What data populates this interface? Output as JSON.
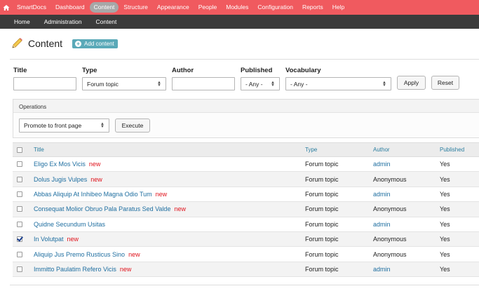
{
  "toolbar": {
    "items": [
      "SmartDocs",
      "Dashboard",
      "Content",
      "Structure",
      "Appearance",
      "People",
      "Modules",
      "Configuration",
      "Reports",
      "Help"
    ],
    "active": "Content",
    "accent_color": "#f05a5f"
  },
  "subbar": {
    "items": [
      "Home",
      "Administration",
      "Content"
    ]
  },
  "page": {
    "title": "Content",
    "add_button": "Add content"
  },
  "filters": {
    "title_label": "Title",
    "title_value": "",
    "type_label": "Type",
    "type_value": "Forum topic",
    "author_label": "Author",
    "author_value": "",
    "published_label": "Published",
    "published_value": "- Any -",
    "vocabulary_label": "Vocabulary",
    "vocabulary_value": "- Any -",
    "apply_label": "Apply",
    "reset_label": "Reset"
  },
  "operations": {
    "title": "Operations",
    "selected": "Promote to front page",
    "execute_label": "Execute"
  },
  "table": {
    "headers": {
      "title": "Title",
      "type": "Type",
      "author": "Author",
      "published": "Published"
    },
    "rows": [
      {
        "title": "Eligo Ex Mos Vicis",
        "badge": "new",
        "type": "Forum topic",
        "author": "admin",
        "author_link": true,
        "published": "Yes",
        "checked": false
      },
      {
        "title": "Dolus Jugis Vulpes",
        "badge": "new",
        "type": "Forum topic",
        "author": "Anonymous",
        "author_link": false,
        "published": "Yes",
        "checked": false
      },
      {
        "title": "Abbas Aliquip At Inhibeo Magna Odio Tum",
        "badge": "new",
        "type": "Forum topic",
        "author": "admin",
        "author_link": true,
        "published": "Yes",
        "checked": false
      },
      {
        "title": "Consequat Molior Obruo Pala Paratus Sed Valde",
        "badge": "new",
        "type": "Forum topic",
        "author": "Anonymous",
        "author_link": false,
        "published": "Yes",
        "checked": false
      },
      {
        "title": "Quidne Secundum Usitas",
        "badge": "",
        "type": "Forum topic",
        "author": "admin",
        "author_link": true,
        "published": "Yes",
        "checked": false
      },
      {
        "title": "In Volutpat",
        "badge": "new",
        "type": "Forum topic",
        "author": "Anonymous",
        "author_link": false,
        "published": "Yes",
        "checked": true
      },
      {
        "title": "Aliquip Jus Premo Rusticus Sino",
        "badge": "new",
        "type": "Forum topic",
        "author": "Anonymous",
        "author_link": false,
        "published": "Yes",
        "checked": false
      },
      {
        "title": "Immitto Paulatim Refero Vicis",
        "badge": "new",
        "type": "Forum topic",
        "author": "admin",
        "author_link": true,
        "published": "Yes",
        "checked": false
      }
    ]
  }
}
